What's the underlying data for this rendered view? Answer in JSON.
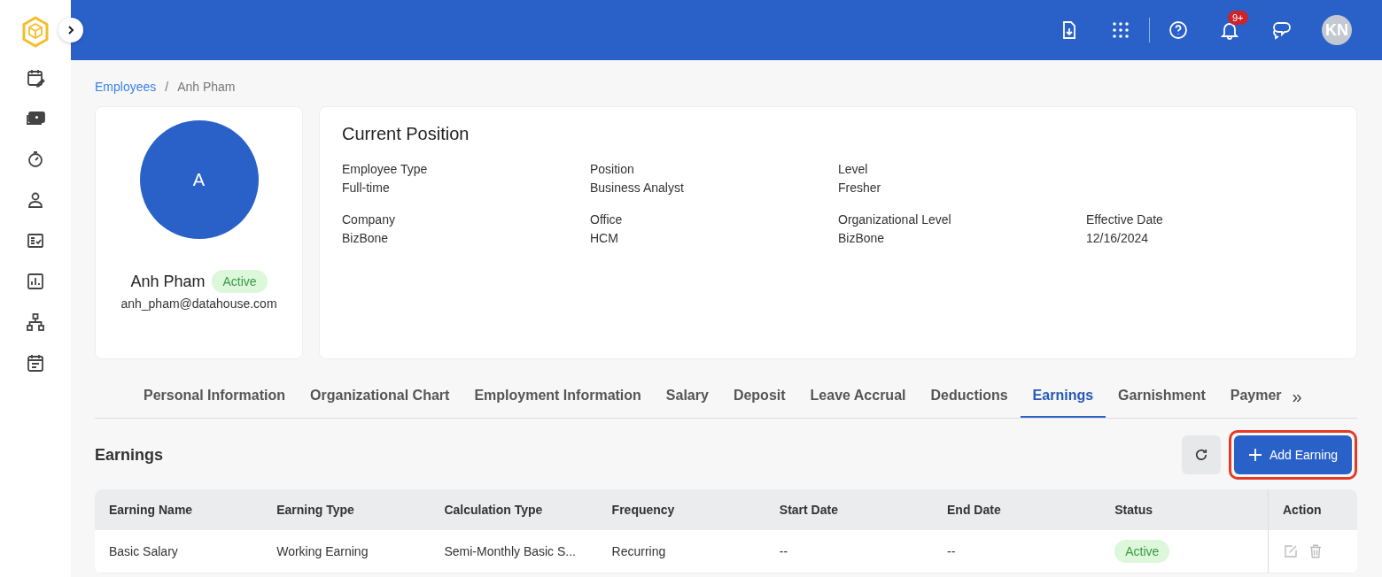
{
  "topbar": {
    "notification_badge": "9+",
    "avatar_initials": "KN"
  },
  "breadcrumb": {
    "parent": "Employees",
    "separator": "/",
    "current": "Anh Pham"
  },
  "profile": {
    "avatar_letter": "A",
    "name": "Anh Pham",
    "status": "Active",
    "email": "anh_pham@datahouse.com"
  },
  "position": {
    "title": "Current Position",
    "rows": [
      [
        {
          "label": "Employee Type",
          "value": "Full-time"
        },
        {
          "label": "Position",
          "value": "Business Analyst"
        },
        {
          "label": "Level",
          "value": "Fresher"
        }
      ],
      [
        {
          "label": "Company",
          "value": "BizBone"
        },
        {
          "label": "Office",
          "value": "HCM"
        },
        {
          "label": "Organizational Level",
          "value": "BizBone"
        },
        {
          "label": "Effective Date",
          "value": "12/16/2024"
        }
      ]
    ]
  },
  "tabs": [
    {
      "label": "Personal Information",
      "selected": false
    },
    {
      "label": "Organizational Chart",
      "selected": false
    },
    {
      "label": "Employment Information",
      "selected": false
    },
    {
      "label": "Salary",
      "selected": false
    },
    {
      "label": "Deposit",
      "selected": false
    },
    {
      "label": "Leave Accrual",
      "selected": false
    },
    {
      "label": "Deductions",
      "selected": false
    },
    {
      "label": "Earnings",
      "selected": true
    },
    {
      "label": "Garnishment",
      "selected": false
    },
    {
      "label": "Paymer",
      "selected": false
    }
  ],
  "tabs_more": "»",
  "section": {
    "title": "Earnings",
    "add_button": "Add Earning",
    "add_button_highlighted": true
  },
  "table": {
    "columns": [
      "Earning Name",
      "Earning Type",
      "Calculation Type",
      "Frequency",
      "Start Date",
      "End Date",
      "Status",
      "Action"
    ],
    "rows": [
      {
        "cells": [
          "Basic Salary",
          "Working Earning",
          "Semi-Monthly Basic S...",
          "Recurring",
          "--",
          "--"
        ],
        "status": "Active"
      }
    ]
  }
}
